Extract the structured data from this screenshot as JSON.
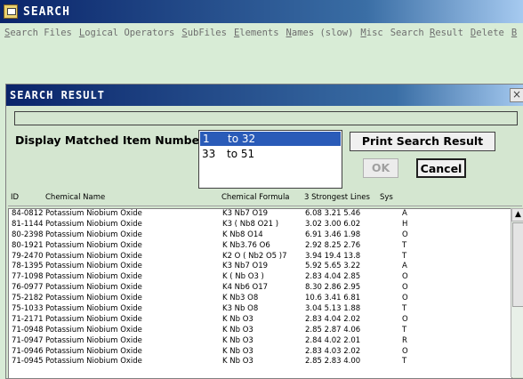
{
  "window": {
    "title": "SEARCH"
  },
  "menu": [
    {
      "pre": "",
      "u": "S",
      "post": "earch Files"
    },
    {
      "pre": "",
      "u": "L",
      "post": "ogical Operators"
    },
    {
      "pre": "",
      "u": "S",
      "post": "ubFiles"
    },
    {
      "pre": "",
      "u": "E",
      "post": "lements"
    },
    {
      "pre": "",
      "u": "N",
      "post": "ames (slow)"
    },
    {
      "pre": "",
      "u": "M",
      "post": "isc"
    },
    {
      "pre": "Search ",
      "u": "R",
      "post": "esult"
    },
    {
      "pre": "",
      "u": "D",
      "post": "elete"
    },
    {
      "pre": "",
      "u": "B",
      "post": ""
    }
  ],
  "dialog": {
    "title": "SEARCH RESULT",
    "close": "×",
    "display_label": "Display Matched Item Number:",
    "ranges": [
      {
        "from": "1",
        "to": "to  32",
        "selected": true
      },
      {
        "from": "33",
        "to": "to 51",
        "selected": false
      }
    ],
    "print_label": "Print Search Result",
    "ok_label": "OK",
    "cancel_label": "Cancel",
    "columns": {
      "id": "ID",
      "name": "Chemical Name",
      "formula": "Chemical Formula",
      "lines": "3 Strongest Lines",
      "sys": "Sys"
    },
    "rows": [
      {
        "id": "84-0812",
        "name": "Potassium Niobium Oxide",
        "formula": "K3 Nb7 O19",
        "lines": "6.08 3.21 5.46",
        "sys": "A"
      },
      {
        "id": "81-1144",
        "name": "Potassium Niobium Oxide",
        "formula": "K3 ( Nb8 O21 )",
        "lines": "3.02 3.00 6.02",
        "sys": "H"
      },
      {
        "id": "80-2398",
        "name": "Potassium Niobium Oxide",
        "formula": "K Nb8 O14",
        "lines": "6.91 3.46 1.98",
        "sys": "O"
      },
      {
        "id": "80-1921",
        "name": "Potassium Niobium Oxide",
        "formula": "K Nb3.76 O6",
        "lines": "2.92 8.25 2.76",
        "sys": "T"
      },
      {
        "id": "79-2470",
        "name": "Potassium Niobium Oxide",
        "formula": "K2 O ( Nb2 O5 )7",
        "lines": "3.94 19.4 13.8",
        "sys": "T"
      },
      {
        "id": "78-1395",
        "name": "Potassium Niobium Oxide",
        "formula": "K3 Nb7 O19",
        "lines": "5.92 5.65 3.22",
        "sys": "A"
      },
      {
        "id": "77-1098",
        "name": "Potassium Niobium Oxide",
        "formula": "K ( Nb O3 )",
        "lines": "2.83 4.04 2.85",
        "sys": "O"
      },
      {
        "id": "76-0977",
        "name": "Potassium Niobium Oxide",
        "formula": "K4 Nb6 O17",
        "lines": "8.30 2.86 2.95",
        "sys": "O"
      },
      {
        "id": "75-2182",
        "name": "Potassium Niobium Oxide",
        "formula": "K Nb3 O8",
        "lines": "10.6 3.41 6.81",
        "sys": "O"
      },
      {
        "id": "75-1033",
        "name": "Potassium Niobium Oxide",
        "formula": "K3 Nb O8",
        "lines": "3.04 5.13 1.88",
        "sys": "T"
      },
      {
        "id": "71-2171",
        "name": "Potassium Niobium Oxide",
        "formula": "K Nb O3",
        "lines": "2.83 4.04 2.02",
        "sys": "O"
      },
      {
        "id": "71-0948",
        "name": "Potassium Niobium Oxide",
        "formula": "K Nb O3",
        "lines": "2.85 2.87 4.06",
        "sys": "T"
      },
      {
        "id": "71-0947",
        "name": "Potassium Niobium Oxide",
        "formula": "K Nb O3",
        "lines": "2.84 4.02 2.01",
        "sys": "R"
      },
      {
        "id": "71-0946",
        "name": "Potassium Niobium Oxide",
        "formula": "K Nb O3",
        "lines": "2.83 4.03 2.02",
        "sys": "O"
      },
      {
        "id": "71-0945",
        "name": "Potassium Niobium Oxide",
        "formula": "K Nb O3",
        "lines": "2.85 2.83 4.00",
        "sys": "T"
      }
    ]
  }
}
